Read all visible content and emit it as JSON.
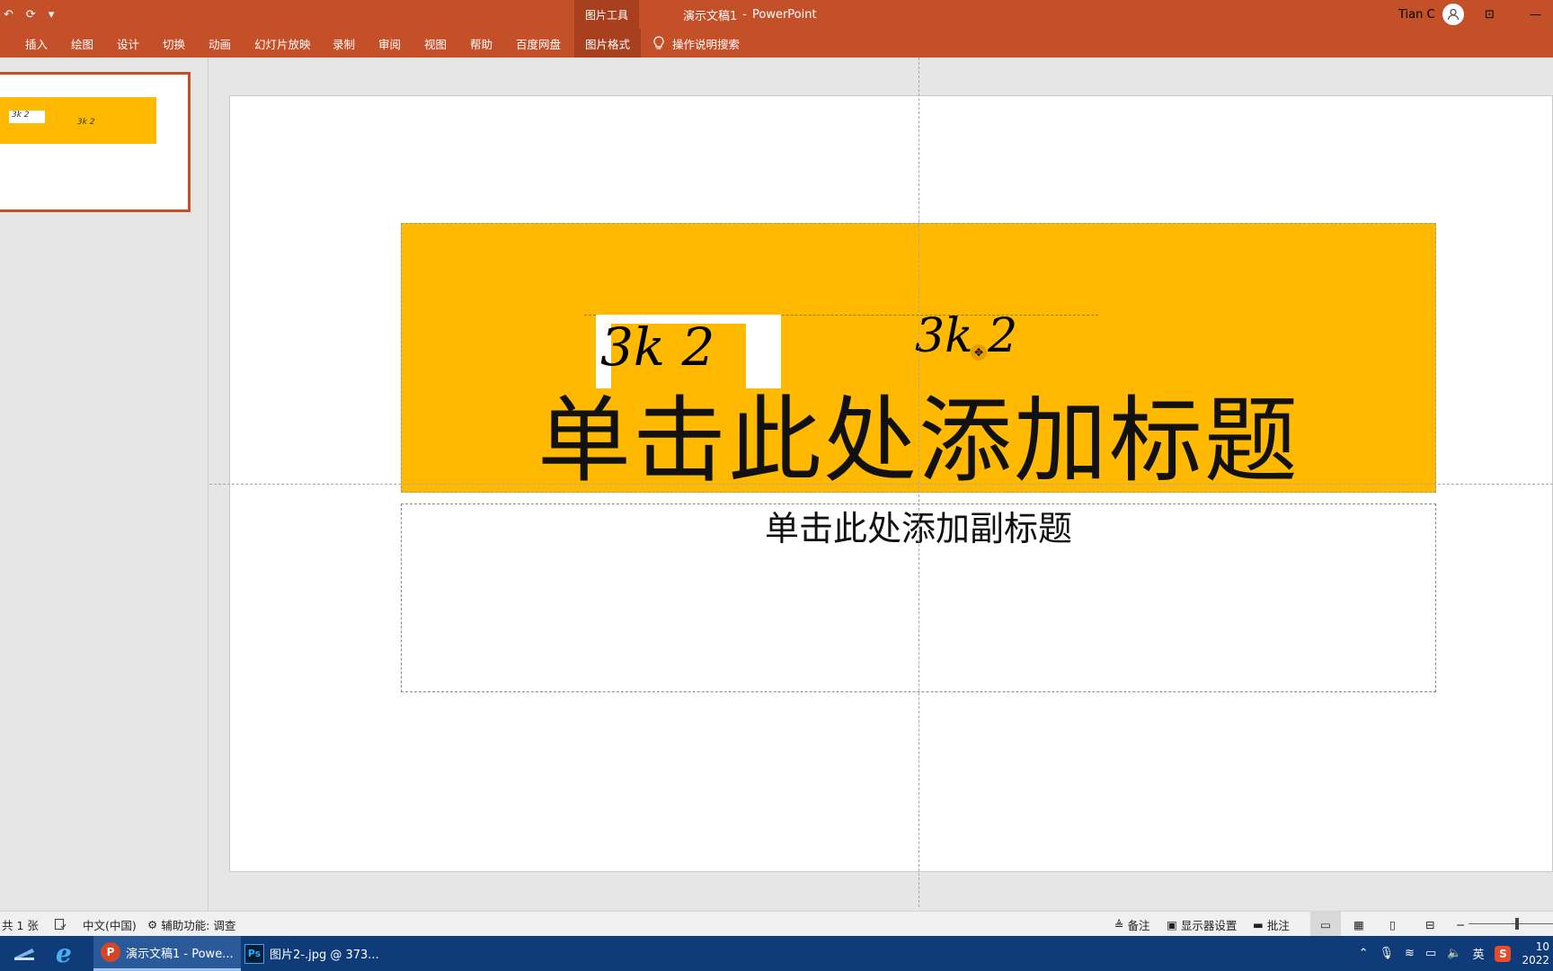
{
  "window": {
    "qat": [
      "↶",
      "⟳",
      "▾"
    ],
    "context_group": "图片工具",
    "doc_name": "演示文稿1",
    "separator": "-",
    "app_name": "PowerPoint",
    "user_name": "Tian C",
    "restore_icon": "⊡",
    "minimize_icon": "—"
  },
  "ribbon": {
    "tabs": [
      "插入",
      "绘图",
      "设计",
      "切换",
      "动画",
      "幻灯片放映",
      "录制",
      "审阅",
      "视图",
      "帮助",
      "百度网盘",
      "图片格式"
    ],
    "tell_me": "操作说明搜索"
  },
  "thumbnail": {
    "sig_a": "3k 2",
    "sig_b": "3k 2"
  },
  "slide": {
    "title_placeholder": "单击此处添加标题",
    "subtitle_placeholder": "单击此处添加副标题",
    "sig_a": "3k 2",
    "sig_b": "3k 2"
  },
  "status": {
    "slide_count": "共 1 张",
    "language": "中文(中国)",
    "accessibility": "辅助功能: 调查",
    "notes": "备注",
    "display_settings": "显示器设置",
    "comments": "批注"
  },
  "taskbar": {
    "ppt_label": "演示文稿1 - Powe...",
    "ps_label": "图片2-.jpg @ 373...",
    "ime": "英",
    "time": "10",
    "date": "2022"
  },
  "colors": {
    "accent": "#c4502a",
    "band": "#ffb900",
    "taskbar": "#0f3c78"
  }
}
